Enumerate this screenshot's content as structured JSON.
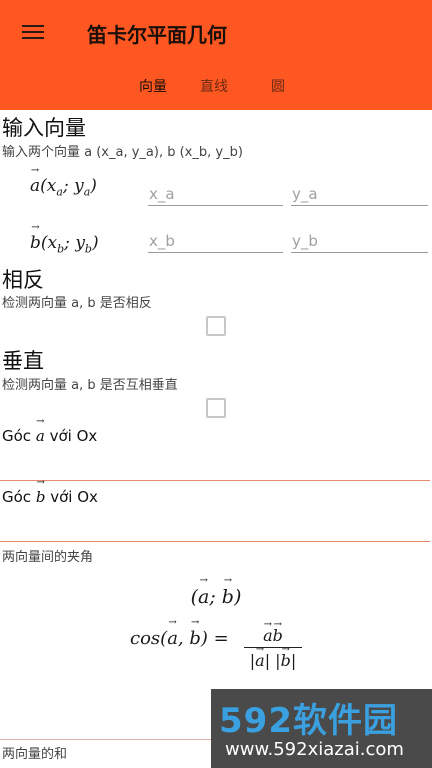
{
  "appbar": {
    "title": "笛卡尔平面几何",
    "tabs": [
      {
        "label": "向量",
        "active": true
      },
      {
        "label": "直线",
        "active": false
      },
      {
        "label": "圆",
        "active": false
      }
    ]
  },
  "input_section": {
    "title": "输入向量",
    "subtitle": "输入两个向量 a (x_a, y_a), b (x_b, y_b)",
    "vector_a": {
      "symbol": "a",
      "x": "x",
      "xsub": "a",
      "y": "y",
      "ysub": "a",
      "x_placeholder": "x_a",
      "y_placeholder": "y_a"
    },
    "vector_b": {
      "symbol": "b",
      "x": "x",
      "xsub": "b",
      "y": "y",
      "ysub": "b",
      "x_placeholder": "x_b",
      "y_placeholder": "y_b"
    }
  },
  "opposite": {
    "title": "相反",
    "subtitle": "检测两向量 a, b 是否相反",
    "checked": false
  },
  "perpendicular": {
    "title": "垂直",
    "subtitle": "检测两向量 a, b 是否互相垂直",
    "checked": false
  },
  "angle_a": {
    "prefix": "Góc",
    "symbol": "a",
    "suffix": "với Ox",
    "value": ""
  },
  "angle_b": {
    "prefix": "Góc",
    "symbol": "b",
    "suffix": "với Ox",
    "value": ""
  },
  "angle_between": {
    "label": "两向量间的夹角",
    "formula_lhs": "cos",
    "a": "a",
    "b": "b"
  },
  "sum": {
    "label": "两向量的和"
  },
  "watermark": {
    "big": "592软件园",
    "small": "www.592xiazai.com"
  },
  "colors": {
    "appbar": "#ff5722",
    "underline": "#e68a6c"
  }
}
